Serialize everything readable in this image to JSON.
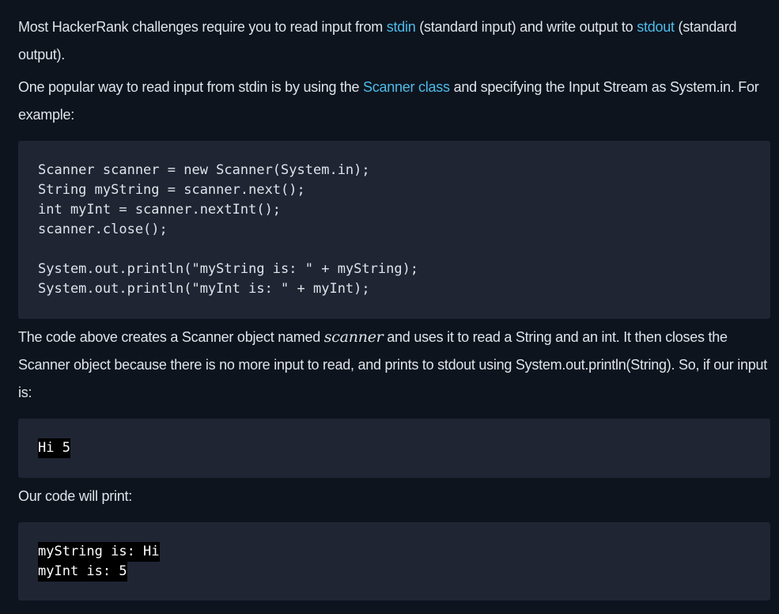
{
  "intro": {
    "t1": "Most HackerRank challenges require you to read input from ",
    "link_stdin": "stdin",
    "t2": " (standard input) and write output to ",
    "link_stdout": "stdout",
    "t3": " (standard output)."
  },
  "scanner_para": {
    "t1": "One popular way to read input from stdin is by using the ",
    "link_scanner": "Scanner class",
    "t2": " and specifying the Input Stream as System.in. For example:"
  },
  "code_example": {
    "lines": [
      "Scanner scanner = new Scanner(System.in);",
      "String myString = scanner.next();",
      "int myInt = scanner.nextInt();",
      "scanner.close();",
      "System.out.println(\"myString is: \" + myString);",
      "System.out.println(\"myInt is: \" + myInt);"
    ]
  },
  "explain_para": {
    "t1": "The code above creates a Scanner object named ",
    "var_name": "scanner",
    "t2": " and uses it to read a String and an int. It then closes the Scanner object because there is no more input to read, and prints to stdout using System.out.println(String). So, if our input is:"
  },
  "input_example": {
    "line": "Hi 5"
  },
  "print_para": {
    "text": "Our code will print:"
  },
  "output_example": {
    "lines": [
      "myString is: Hi",
      "myInt is: 5"
    ]
  },
  "colors": {
    "background": "#0e141e",
    "code_background": "#1f2533",
    "link": "#4dbbe8",
    "text": "#dfe4ea"
  }
}
